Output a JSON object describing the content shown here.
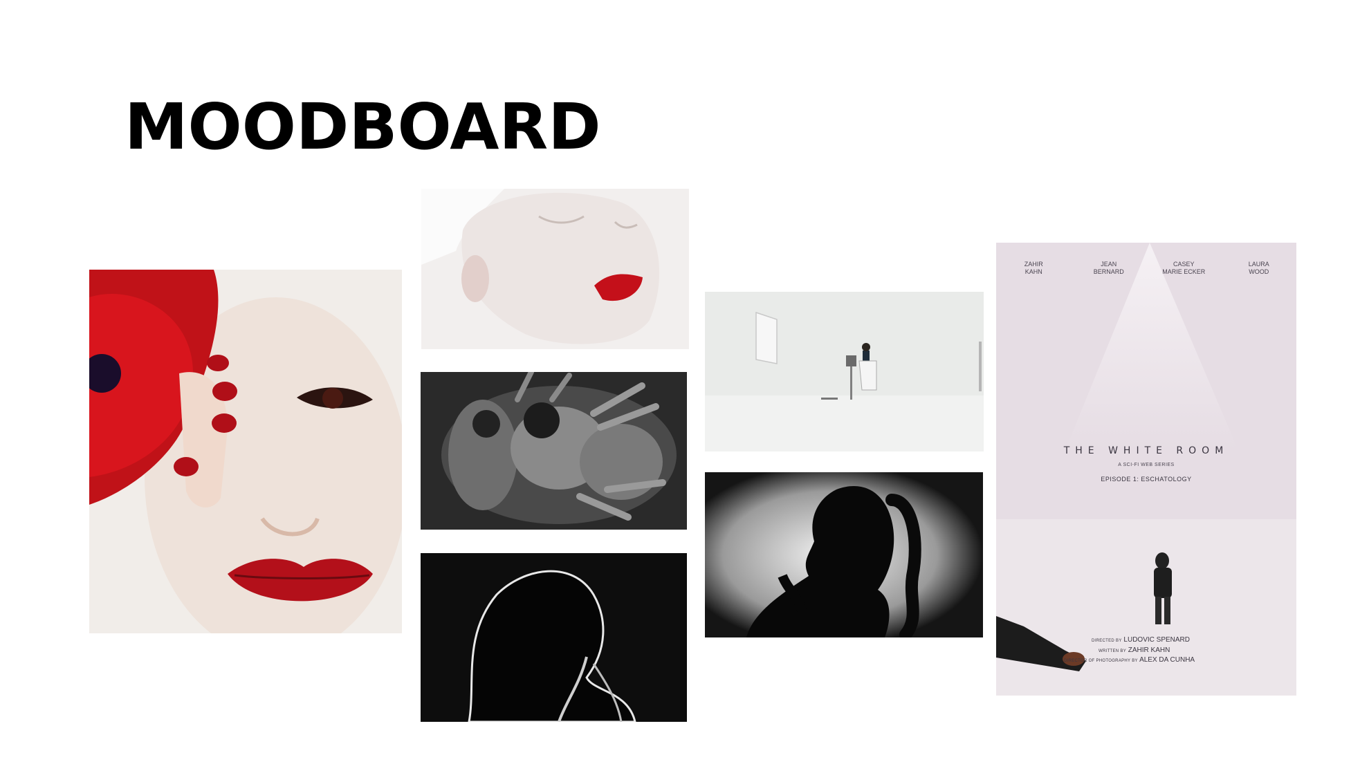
{
  "slide": {
    "title": "MOODBOARD"
  },
  "poster": {
    "cast": [
      "ZAHIR\nKAHN",
      "JEAN\nBERNARD",
      "CASEY\nMARIE ECKER",
      "LAURA\nWOOD"
    ],
    "title": "THE WHITE ROOM",
    "subtitle": "A SCI-FI WEB SERIES",
    "episode": "EPISODE 1: ESCHATOLOGY",
    "credits": [
      {
        "role": "DIRECTED BY",
        "name": "LUDOVIC SPENARD"
      },
      {
        "role": "WRITTEN BY",
        "name": "ZAHIR KAHN"
      },
      {
        "role": "DIRECTOR OF PHOTOGRAPHY BY",
        "name": "ALEX DA CUNHA"
      }
    ]
  },
  "colors": {
    "accent_red": "#c4101a",
    "poster_bg": "#e6dde4"
  }
}
